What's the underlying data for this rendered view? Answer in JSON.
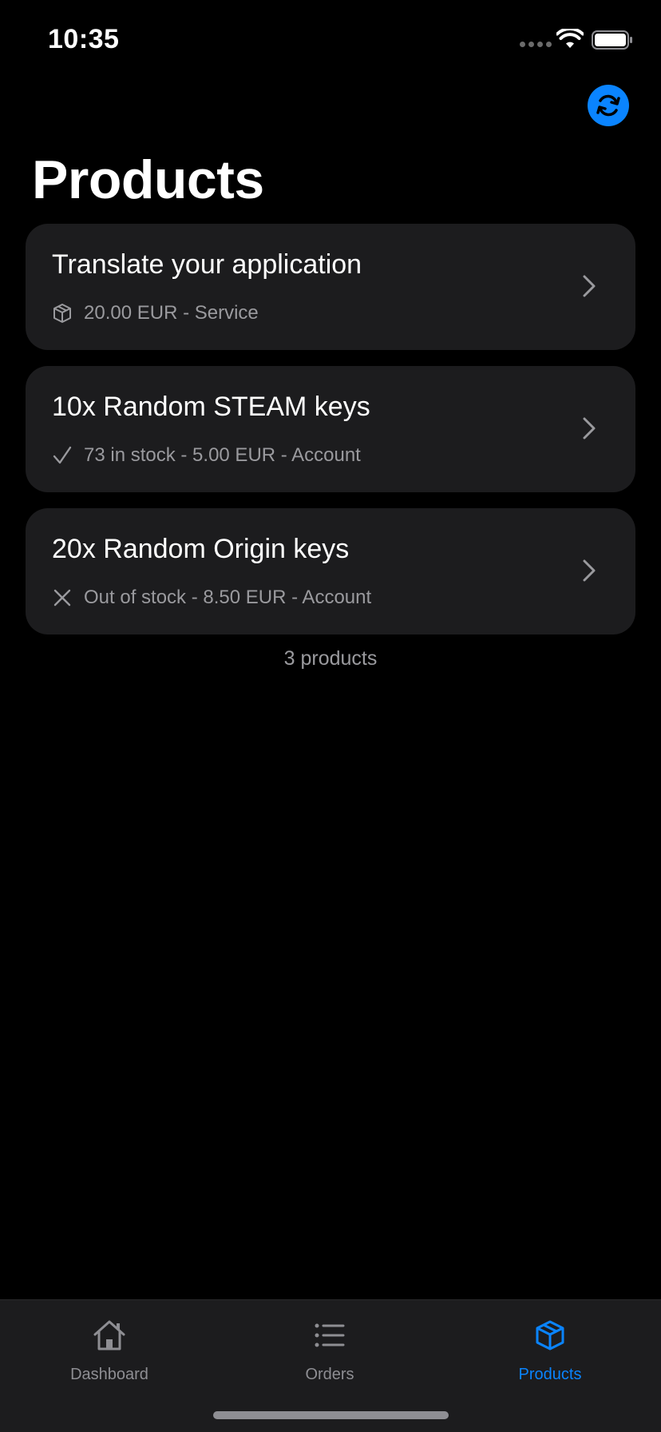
{
  "status_bar": {
    "time": "10:35"
  },
  "header": {
    "title": "Products"
  },
  "products": [
    {
      "name": "Translate your application",
      "meta": "20.00 EUR - Service",
      "status_icon": "package-icon"
    },
    {
      "name": "10x Random STEAM keys",
      "meta": "73 in stock - 5.00 EUR - Account",
      "status_icon": "checkmark-icon"
    },
    {
      "name": "20x Random Origin keys",
      "meta": "Out of stock - 8.50 EUR - Account",
      "status_icon": "x-icon"
    }
  ],
  "footer": {
    "count_label": "3 products"
  },
  "tabs": [
    {
      "label": "Dashboard",
      "icon": "house-icon",
      "active": false
    },
    {
      "label": "Orders",
      "icon": "list-icon",
      "active": false
    },
    {
      "label": "Products",
      "icon": "package-icon",
      "active": true
    }
  ],
  "colors": {
    "accent": "#0a84ff",
    "card": "#1c1c1e",
    "secondary_text": "#9a9a9e",
    "background": "#000000"
  }
}
